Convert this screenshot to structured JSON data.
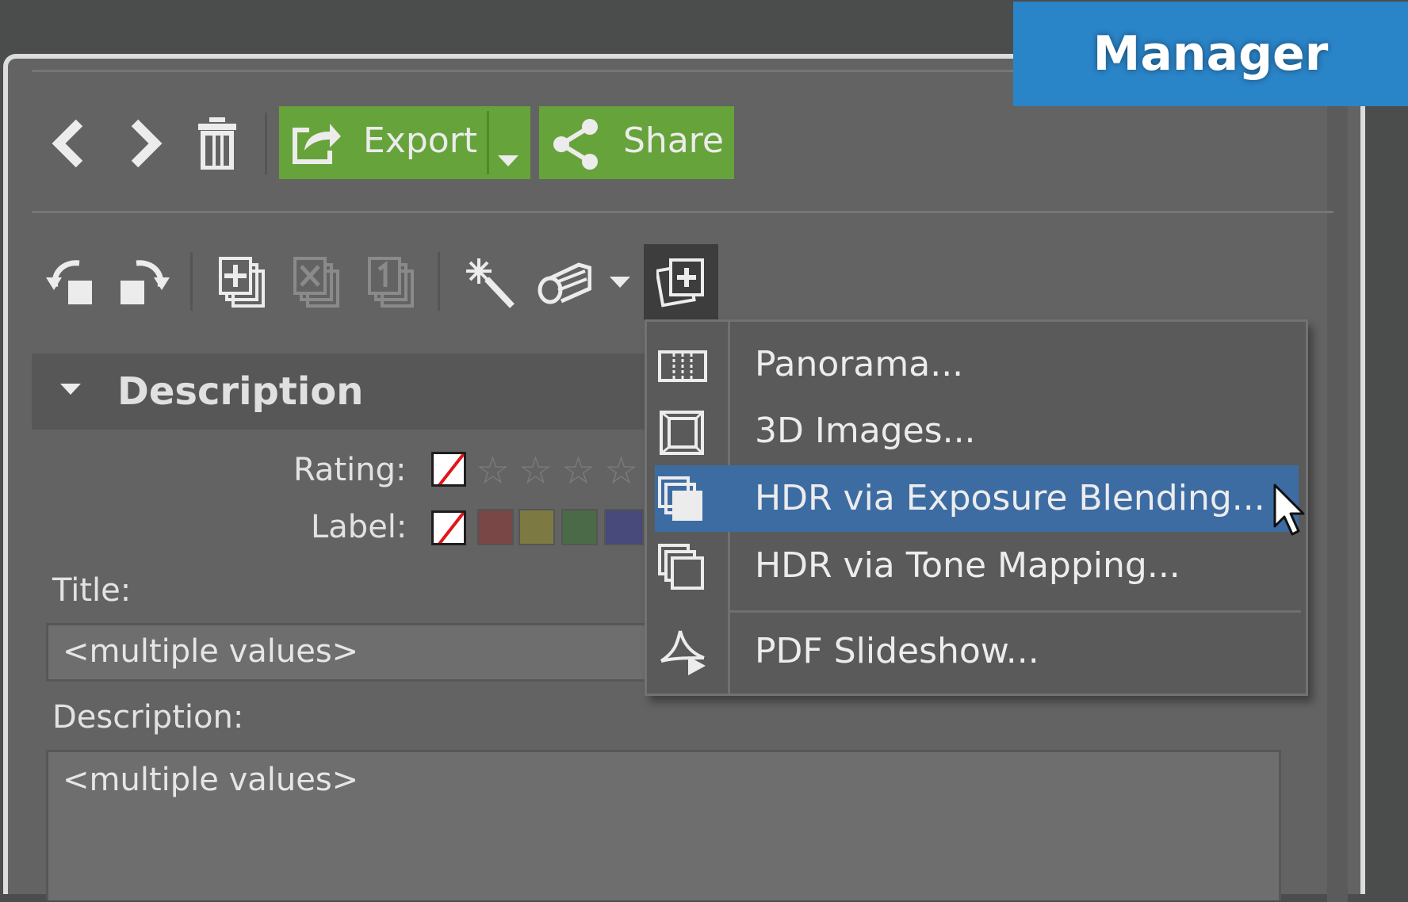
{
  "badge": {
    "text": "Manager"
  },
  "toolbar": {
    "icons": [
      "chevron-left-icon",
      "chevron-right-icon",
      "trash-icon"
    ],
    "export_label": "Export",
    "share_label": "Share",
    "colors": {
      "green": "#67a33b"
    }
  },
  "toolbar2": {
    "icons": [
      "rotate-left-icon",
      "rotate-right-icon",
      "duplicate-icon",
      "remove-duplicate-icon",
      "number-duplicate-icon",
      "magic-wand-icon",
      "batch-icon",
      "create-icon"
    ]
  },
  "description": {
    "section_title": "Description",
    "rating_label": "Rating:",
    "label_label": "Label:",
    "label_colors": [
      "#7a4747",
      "#7c7a42",
      "#4b6a48",
      "#484a7c"
    ],
    "title_label": "Title:",
    "title_value": "<multiple values>",
    "description_label": "Description:",
    "description_value": "<multiple values>"
  },
  "menu": {
    "items": [
      {
        "label": "Panorama...",
        "icon": "panorama-icon"
      },
      {
        "label": "3D Images...",
        "icon": "cube-icon"
      },
      {
        "label": "HDR via Exposure Blending...",
        "icon": "hdr-stack-icon",
        "highlighted": true
      },
      {
        "label": "HDR via Tone Mapping...",
        "icon": "hdr-stack-icon"
      },
      {
        "label": "PDF Slideshow...",
        "icon": "pdf-icon"
      }
    ],
    "highlight_color": "#3d6ca3"
  }
}
